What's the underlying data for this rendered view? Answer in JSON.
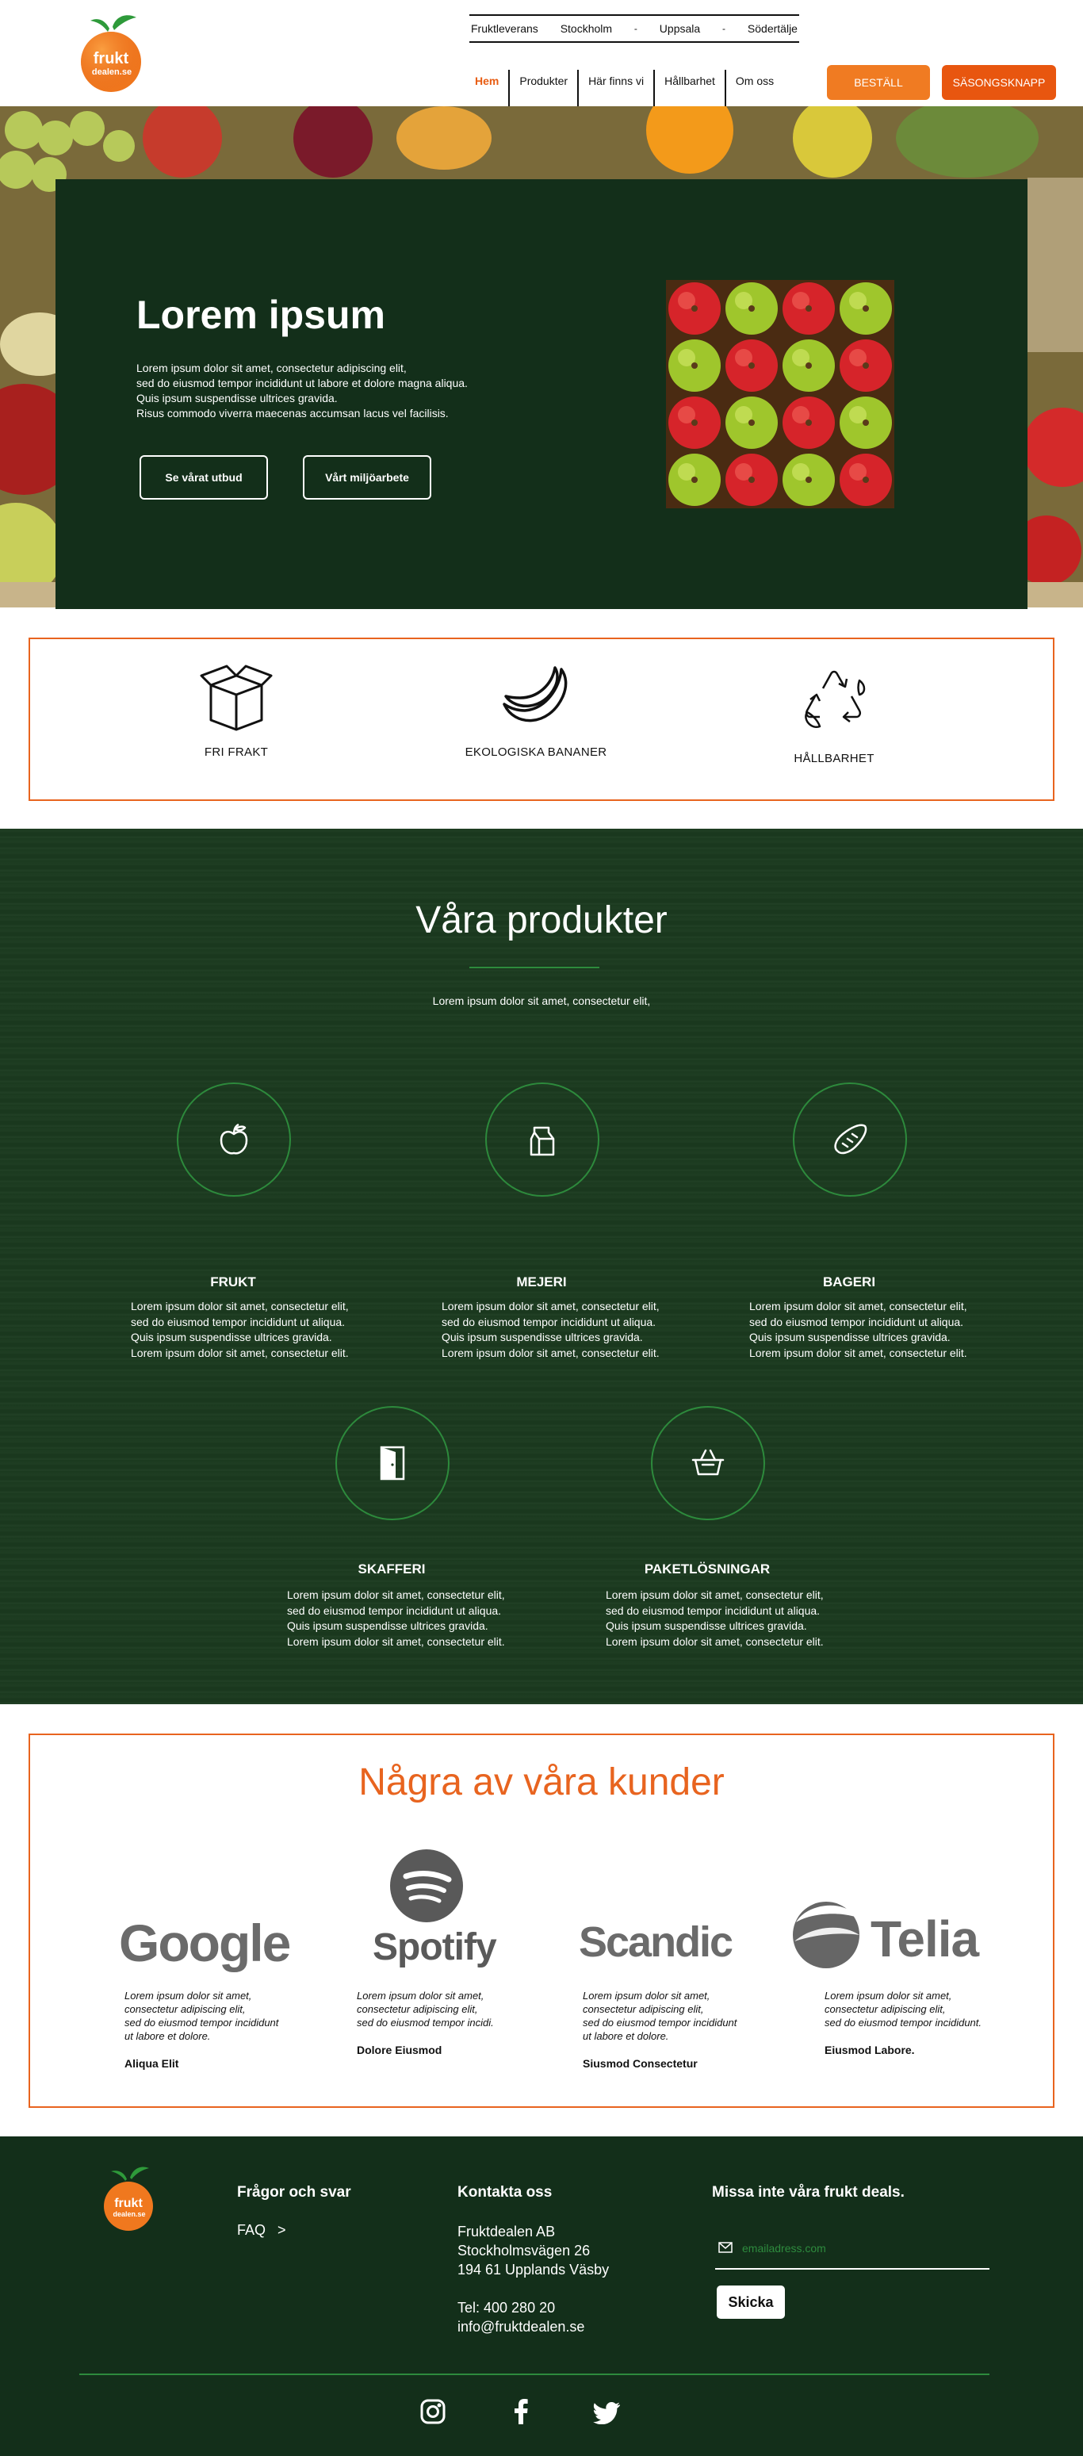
{
  "header": {
    "logo_line1": "frukt",
    "logo_line2": "dealen.se",
    "top_links": [
      "Fruktleverans",
      "Stockholm",
      "Uppsala",
      "Södertälje"
    ],
    "top_separators": [
      "-",
      "-"
    ],
    "main_nav": [
      "Hem",
      "Produkter",
      "Här finns vi",
      "Hållbarhet",
      "Om oss"
    ],
    "active_nav": "Hem",
    "order_button": "BESTÄLL",
    "season_button": "SÄSONGSKNAPP"
  },
  "hero": {
    "title": "Lorem ipsum",
    "text_lines": [
      "Lorem ipsum dolor sit amet, consectetur adipiscing elit,",
      "sed do eiusmod tempor incididunt ut labore et dolore magna aliqua.",
      "Quis ipsum suspendisse ultrices gravida.",
      "Risus commodo viverra maecenas accumsan lacus vel facilisis."
    ],
    "button_1": "Se vårat utbud",
    "button_2": "Vårt miljöarbete"
  },
  "features": [
    {
      "label": "FRI FRAKT",
      "icon": "box-icon"
    },
    {
      "label": "EKOLOGISKA BANANER",
      "icon": "banana-icon"
    },
    {
      "label": "HÅLLBARHET",
      "icon": "recycle-icon"
    }
  ],
  "products": {
    "title": "Våra produkter",
    "subtitle": "Lorem ipsum dolor sit amet, consectetur elit,",
    "items": [
      {
        "title": "FRUKT",
        "icon": "apple-icon",
        "lines": [
          "Lorem ipsum dolor sit amet, consectetur elit,",
          "sed do eiusmod tempor incididunt ut aliqua.",
          "Quis ipsum suspendisse ultrices gravida.",
          "Lorem ipsum dolor sit amet, consectetur elit."
        ]
      },
      {
        "title": "MEJERI",
        "icon": "milk-icon",
        "lines": [
          "Lorem ipsum dolor sit amet, consectetur elit,",
          "sed do eiusmod tempor incididunt ut aliqua.",
          "Quis ipsum suspendisse ultrices gravida.",
          "Lorem ipsum dolor sit amet, consectetur elit."
        ]
      },
      {
        "title": "BAGERI",
        "icon": "bread-icon",
        "lines": [
          "Lorem ipsum dolor sit amet, consectetur elit,",
          "sed do eiusmod tempor incididunt ut aliqua.",
          "Quis ipsum suspendisse ultrices gravida.",
          "Lorem ipsum dolor sit amet, consectetur elit."
        ]
      },
      {
        "title": "SKAFFERI",
        "icon": "pantry-door-icon",
        "lines": [
          "Lorem ipsum dolor sit amet, consectetur elit,",
          "sed do eiusmod tempor incididunt ut aliqua.",
          "Quis ipsum suspendisse ultrices gravida.",
          "Lorem ipsum dolor sit amet, consectetur elit."
        ]
      },
      {
        "title": "PAKETLÖSNINGAR",
        "icon": "basket-icon",
        "lines": [
          "Lorem ipsum dolor sit amet, consectetur elit,",
          "sed do eiusmod tempor incididunt ut aliqua.",
          "Quis ipsum suspendisse ultrices gravida.",
          "Lorem ipsum dolor sit amet, consectetur elit."
        ]
      }
    ]
  },
  "customers": {
    "title": "Några av våra kunder",
    "items": [
      {
        "logo": "Google",
        "lines": [
          "Lorem ipsum dolor sit amet,",
          "consectetur adipiscing elit,",
          "sed do eiusmod tempor incididunt",
          "ut labore et dolore."
        ],
        "name": "Aliqua Elit"
      },
      {
        "logo": "Spotify",
        "lines": [
          "Lorem ipsum dolor sit amet,",
          "consectetur adipiscing elit,",
          "sed do eiusmod tempor incidi."
        ],
        "name": "Dolore Eiusmod"
      },
      {
        "logo": "Scandic",
        "lines": [
          "Lorem ipsum dolor sit amet,",
          "consectetur adipiscing elit,",
          "sed do eiusmod tempor incididunt",
          "ut labore et dolore."
        ],
        "name": "Siusmod Consectetur"
      },
      {
        "logo": "Telia",
        "lines": [
          "Lorem ipsum dolor sit amet,",
          "consectetur adipiscing elit,",
          "sed do eiusmod tempor incididunt."
        ],
        "name": "Eiusmod Labore."
      }
    ]
  },
  "footer": {
    "logo_line1": "frukt",
    "logo_line2": "dealen.se",
    "faq_heading": "Frågor och svar",
    "faq_link": "FAQ",
    "faq_arrow": ">",
    "contact_heading": "Kontakta oss",
    "company": "Fruktdealen AB",
    "street": "Stockholmsvägen 26",
    "city": "194 61 Upplands Väsby",
    "phone": "Tel: 400 280 20",
    "email": "info@fruktdealen.se",
    "newsletter_heading": "Missa inte våra frukt deals.",
    "newsletter_placeholder": "emailadress.com",
    "subscribe": "Skicka"
  },
  "colors": {
    "accent_orange": "#e8641f",
    "dark_green": "#132f1a",
    "line_green": "#2d8a3c"
  }
}
